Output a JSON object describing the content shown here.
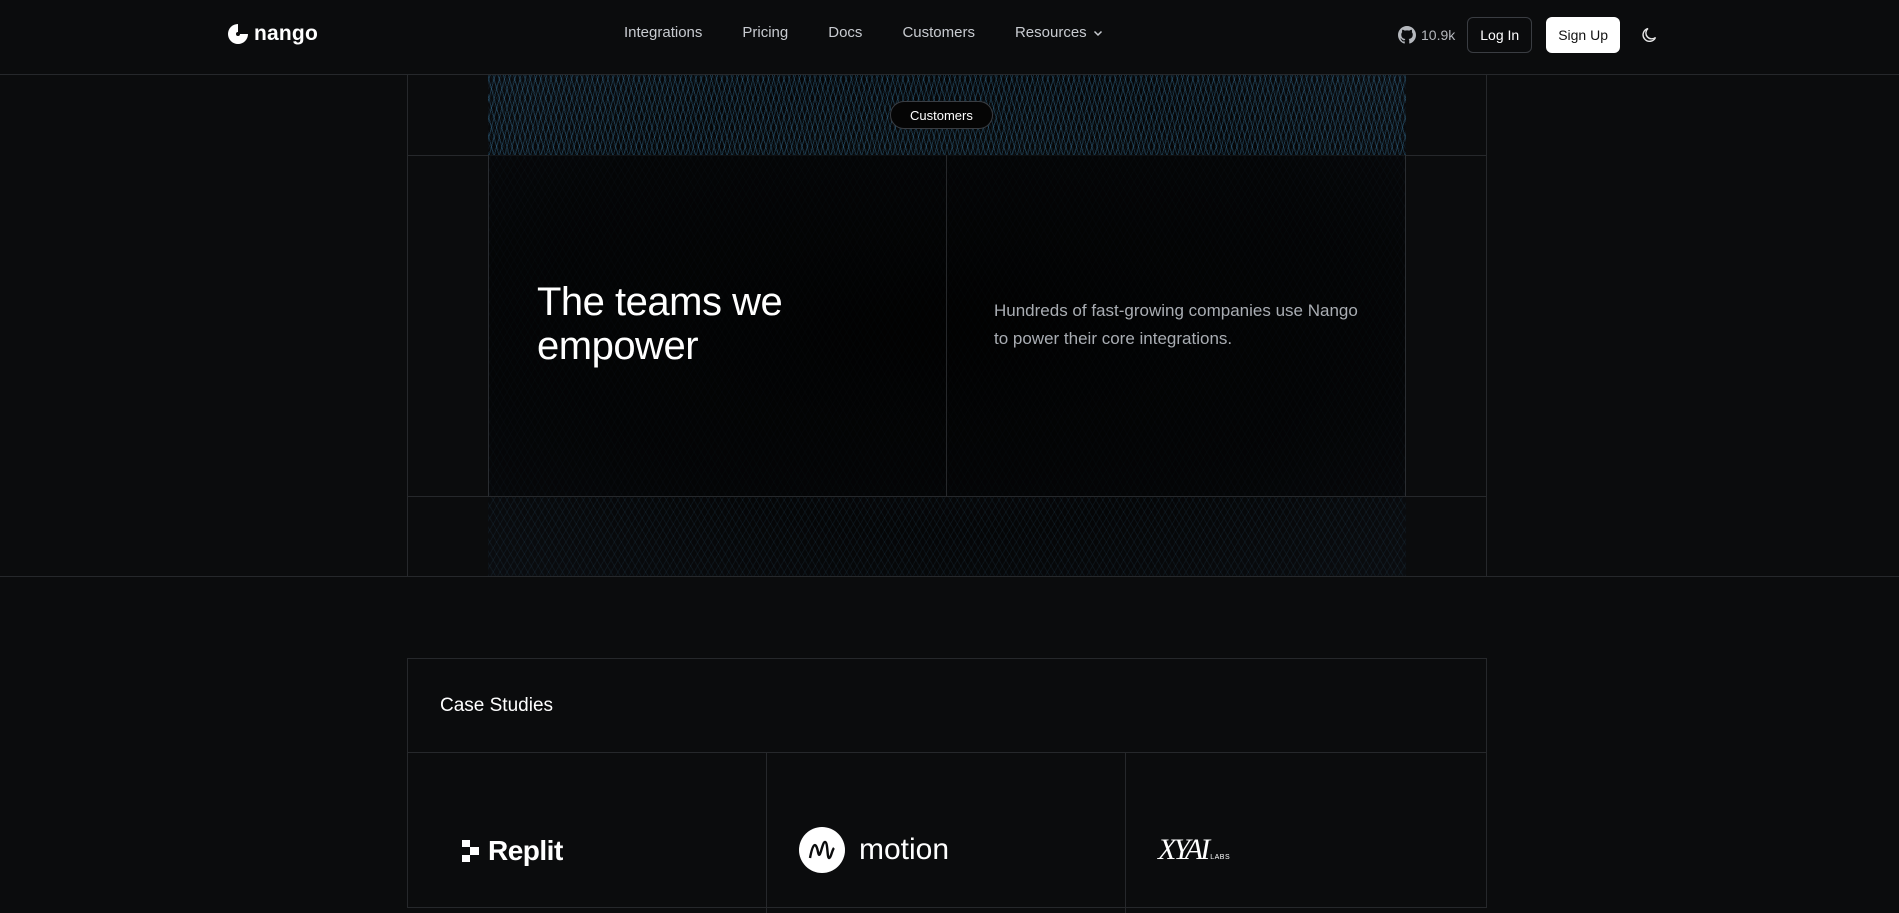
{
  "nav": {
    "logo_text": "nango",
    "menu": [
      {
        "label": "Integrations"
      },
      {
        "label": "Pricing"
      },
      {
        "label": "Docs"
      },
      {
        "label": "Customers"
      },
      {
        "label": "Resources"
      }
    ],
    "github_stars": "10.9k",
    "login_label": "Log In",
    "signup_label": "Sign Up"
  },
  "hero": {
    "badge": "Customers",
    "title": "The teams we empower",
    "subtitle": "Hundreds of fast-growing companies use Nango to power their core integrations."
  },
  "case_studies": {
    "title": "Case Studies",
    "logos": [
      {
        "name": "Replit"
      },
      {
        "name": "motion"
      },
      {
        "name": "XYAI",
        "suffix": "LABS"
      }
    ]
  }
}
